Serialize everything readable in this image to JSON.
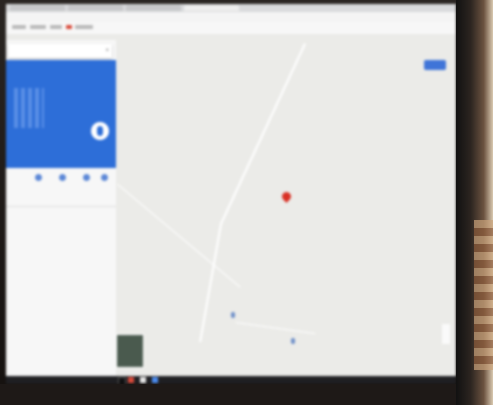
{
  "colors": {
    "map_background": "#ebebe8",
    "panel_hero": "#2d6ed8",
    "pin": "#d93025",
    "signin_button": "#3f74d8",
    "taskbar": "#1f1f22"
  },
  "browser": {
    "tabs": [
      "",
      "",
      "",
      ""
    ],
    "bookmarks": [
      "",
      "",
      "",
      "",
      ""
    ]
  },
  "panel": {
    "search_value": "",
    "close_icon": "close-icon",
    "hero_title": "",
    "directions_label": "",
    "actions": [
      {
        "icon": "save-icon",
        "label": ""
      },
      {
        "icon": "nearby-icon",
        "label": ""
      },
      {
        "icon": "send-to-phone-icon",
        "label": ""
      },
      {
        "icon": "share-icon",
        "label": ""
      }
    ],
    "info_lines": [
      "",
      "",
      "",
      ""
    ]
  },
  "map": {
    "signin_label": "",
    "place_labels": [
      "",
      ""
    ]
  },
  "taskbar": {
    "tray_text": ""
  }
}
